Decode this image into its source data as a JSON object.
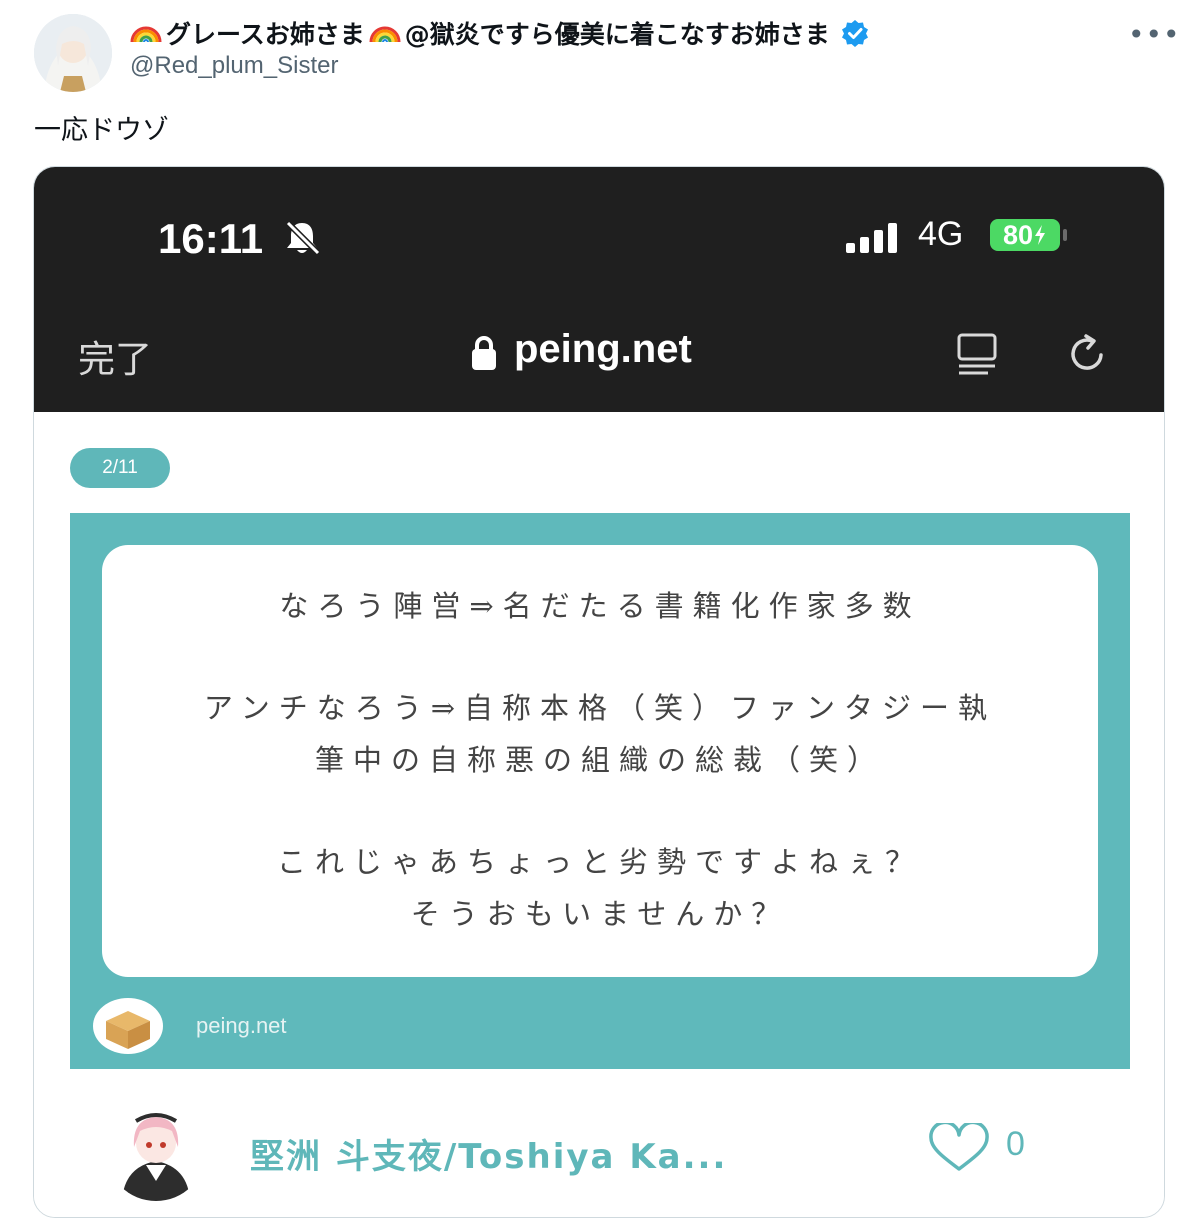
{
  "tweet": {
    "display_name_part1": "グレースお姉さま",
    "display_name_part2": "@獄炎ですら優美に着こなすお姉さま",
    "handle": "@Red_plum_Sister",
    "more_label": "•••",
    "text": "一応ドウゾ",
    "verified_color": "#1d9bf0"
  },
  "screenshot": {
    "status_bar": {
      "time": "16:11",
      "network": "4G",
      "battery": "80"
    },
    "browser": {
      "done_label": "完了",
      "url": "peing.net"
    },
    "page_counter": "2/11",
    "question_lines": [
      "なろう陣営⇒名だたる書籍化作家多数",
      "アンチなろう⇒自称本格（笑）ファンタジー執",
      "筆中の自称悪の組織の総裁（笑）",
      "これじゃあちょっと劣勢ですよねぇ？",
      "そうおもいませんか？"
    ],
    "brand": "peing.net",
    "answerer_name": "堅洲 斗支夜/Toshiya Ka...",
    "like_count": "0",
    "accent_color": "#5fb9bb"
  }
}
